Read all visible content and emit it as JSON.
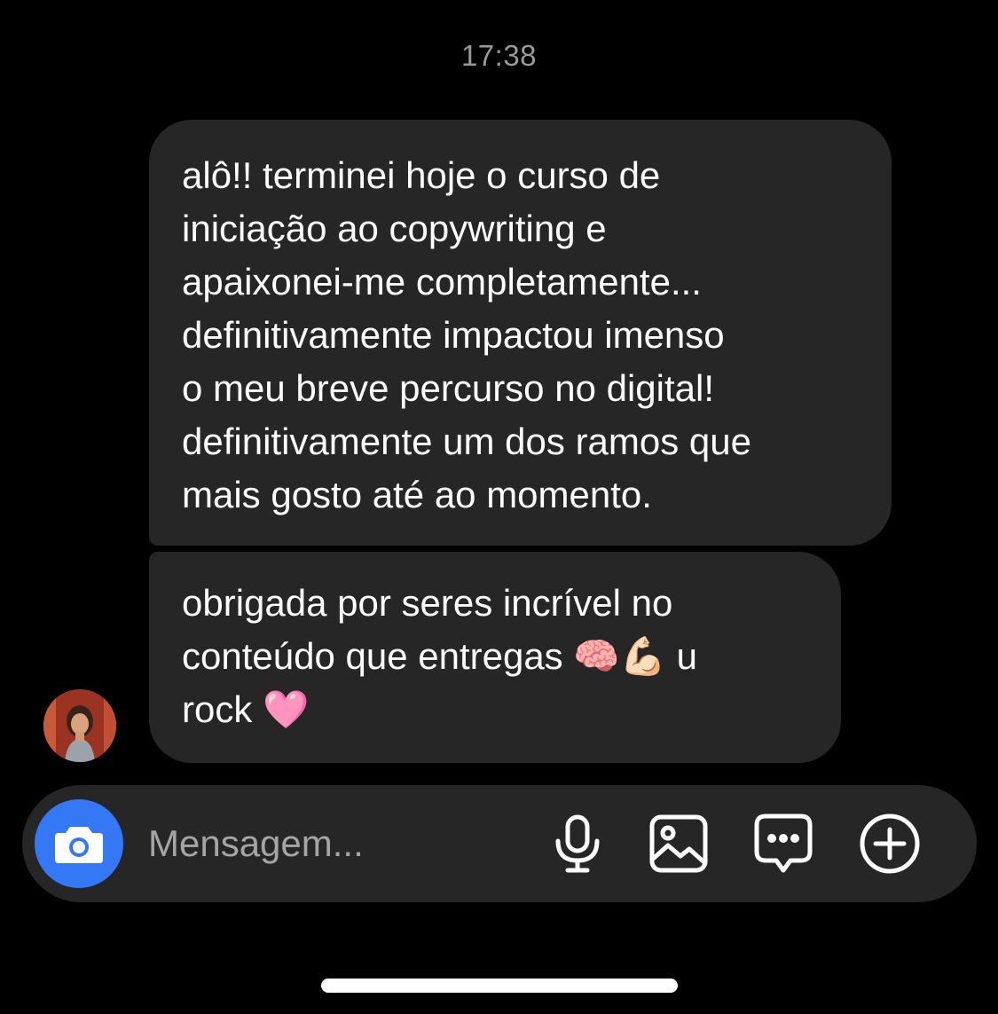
{
  "chat": {
    "timestamp": "17:38",
    "messages": [
      {
        "text": "alô!! terminei hoje o curso de\niniciação ao copywriting e\napaixonei-me completamente...\ndefinitivamente impactou imenso\no meu breve percurso no digital!\ndefinitivamente um dos ramos que\nmais gosto até ao momento."
      },
      {
        "text": "obrigada por seres incrível no\nconteúdo que entregas 🧠💪🏻 u\nrock 🩷"
      }
    ]
  },
  "composer": {
    "placeholder": "Mensagem..."
  },
  "icons": {
    "camera": "camera-icon",
    "mic": "microphone-icon",
    "gallery": "image-icon",
    "sticker": "chat-bubble-icon",
    "plus": "plus-circle-icon"
  },
  "colors": {
    "background": "#000000",
    "bubble": "#262626",
    "accent": "#3478f6",
    "timestamp": "#9a9a9a"
  }
}
